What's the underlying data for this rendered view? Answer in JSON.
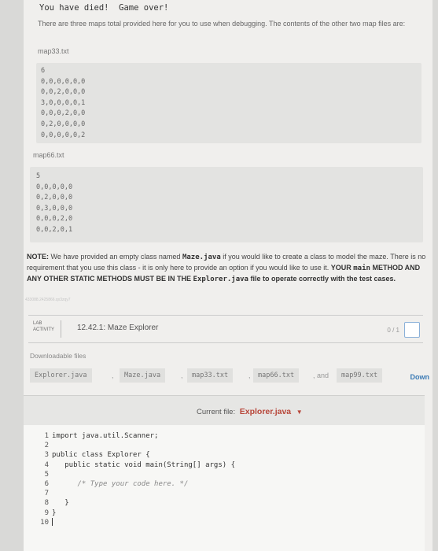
{
  "header": {
    "message_text": "You have died!  Game over!"
  },
  "intro_text": "There are three maps total provided here for you to use when debugging. The contents of the other two map files are:",
  "maps": [
    {
      "filename": "map33.txt",
      "lines": [
        "6",
        "0,0,0,0,0,0",
        "0,0,2,0,0,0",
        "3,0,0,0,0,1",
        "0,0,0,2,0,0",
        "0,2,0,0,0,0",
        "0,0,0,0,0,2"
      ]
    },
    {
      "filename": "map66.txt",
      "lines": [
        "5",
        "0,0,0,0,0",
        "0,2,0,0,0",
        "0,3,0,0,0",
        "0,0,0,2,0",
        "0,0,2,0,1"
      ]
    }
  ],
  "note": {
    "label": "NOTE:",
    "part1": "We have provided an empty class named",
    "class_name": "Maze.java",
    "part2": "if you would like to create a class to model the maze. There is no requirement that you use this class - it is only here to provide an option if you would like to use it.",
    "bold1": "YOUR",
    "bold_code": "main",
    "bold2": "METHOD AND ANY OTHER STATIC METHODS MUST BE IN THE",
    "bold_file": "Explorer.java",
    "bold3": "file to operate correctly with the test cases."
  },
  "watermark": "433088.2425866.qx3zqy7",
  "lab": {
    "badge_line1": "LAB",
    "badge_line2": "ACTIVITY",
    "title": "12.42.1: Maze Explorer",
    "score": "0 / 1"
  },
  "downloads": {
    "label": "Downloadable files",
    "files": [
      "Explorer.java",
      "Maze.java",
      "map33.txt",
      "map66.txt",
      "map99.txt"
    ],
    "separator_comma": ",",
    "separator_and": ", and",
    "download_label": "Down"
  },
  "editor": {
    "current_file_label": "Current file:",
    "current_file_name": "Explorer.java",
    "line_numbers": [
      "1",
      "2",
      "3",
      "4",
      "5",
      "6",
      "7",
      "8",
      "9",
      "10"
    ],
    "code_lines": [
      "import java.util.Scanner;",
      "",
      "public class Explorer {",
      "   public static void main(String[] args) {",
      "",
      "      /* Type your code here. */",
      "",
      "   }",
      "}",
      ""
    ]
  },
  "colors": {
    "accent_file": "#b8473a",
    "download_link": "#3a7ab5"
  }
}
